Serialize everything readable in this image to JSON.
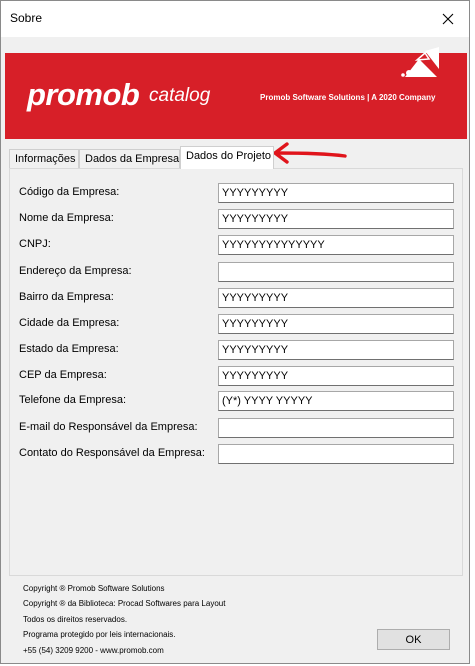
{
  "window": {
    "title": "Sobre"
  },
  "banner": {
    "logo_main": "promob",
    "logo_sub": "catalog",
    "company": "Promob Software Solutions | A 2020 Company",
    "background_color": "#d71f28"
  },
  "tabs": [
    {
      "label": "Informações",
      "active": false
    },
    {
      "label": "Dados da Empresa",
      "active": false
    },
    {
      "label": "Dados do Projeto",
      "active": true
    }
  ],
  "fields": [
    {
      "label": "Código da Empresa:",
      "value": "YYYYYYYYY"
    },
    {
      "label": "Nome da Empresa:",
      "value": "YYYYYYYYY"
    },
    {
      "label": "CNPJ:",
      "value": "YYYYYYYYYYYYYY"
    },
    {
      "label": "Endereço da Empresa:",
      "value": ""
    },
    {
      "label": "Bairro da Empresa:",
      "value": "YYYYYYYYY"
    },
    {
      "label": "Cidade da Empresa:",
      "value": "YYYYYYYYY"
    },
    {
      "label": "Estado da Empresa:",
      "value": "YYYYYYYYY"
    },
    {
      "label": "CEP da Empresa:",
      "value": "YYYYYYYYY"
    },
    {
      "label": "Telefone da Empresa:",
      "value": "(Y*) YYYY YYYYY"
    },
    {
      "label": "E-mail do Responsável da Empresa:",
      "value": ""
    },
    {
      "label": "Contato do Responsável da Empresa:",
      "value": ""
    }
  ],
  "footer": {
    "lines": [
      "Copyright ® Promob Software Solutions",
      "Copyright ® da Biblioteca: Procad Softwares para Layout",
      "Todos os direitos reservados.",
      "Programa protegido por leis internacionais.",
      "+55 (54) 3209 9200  -  www.promob.com"
    ]
  },
  "buttons": {
    "ok": "OK"
  },
  "annotation": {
    "arrow_color": "#e0141b"
  }
}
